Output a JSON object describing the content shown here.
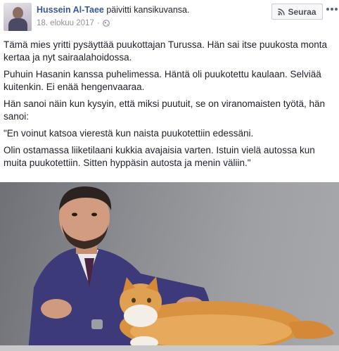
{
  "post": {
    "author": "Hussein Al-Taee",
    "action": " päivitti kansikuvansa.",
    "date": "18. elokuu 2017",
    "separator": "·",
    "privacy_icon": "globe-icon",
    "follow_label": "Seuraa",
    "follow_icon": "rss-icon",
    "more_icon": "more-options-icon",
    "paragraphs": [
      "Tämä mies yritti pysäyttää puukottajan Turussa. Hän sai itse puukosta monta kertaa ja nyt sairaalahoidossa.",
      "Puhuin Hasanin kanssa puhelimessa. Häntä oli puukotettu kaulaan. Selviää kuitenkin. Ei enää hengenvaaraa.",
      "Hän sanoi näin kun kysyin, että miksi puutuit, se on viranomaisten työtä, hän sanoi:",
      "\"En voinut katsoa vierestä kun naista puukotettiin edessäni.",
      "Olin ostamassa liiketilaani kukkia avajaisia varten. Istuin vielä autossa kun muita puukotettiin. Sitten hyppäsin autosta ja menin väliin.\""
    ]
  },
  "colors": {
    "author_link": "#365899",
    "meta_text": "#90949c",
    "body_text": "#1d2129",
    "button_bg": "#f6f7f9"
  }
}
